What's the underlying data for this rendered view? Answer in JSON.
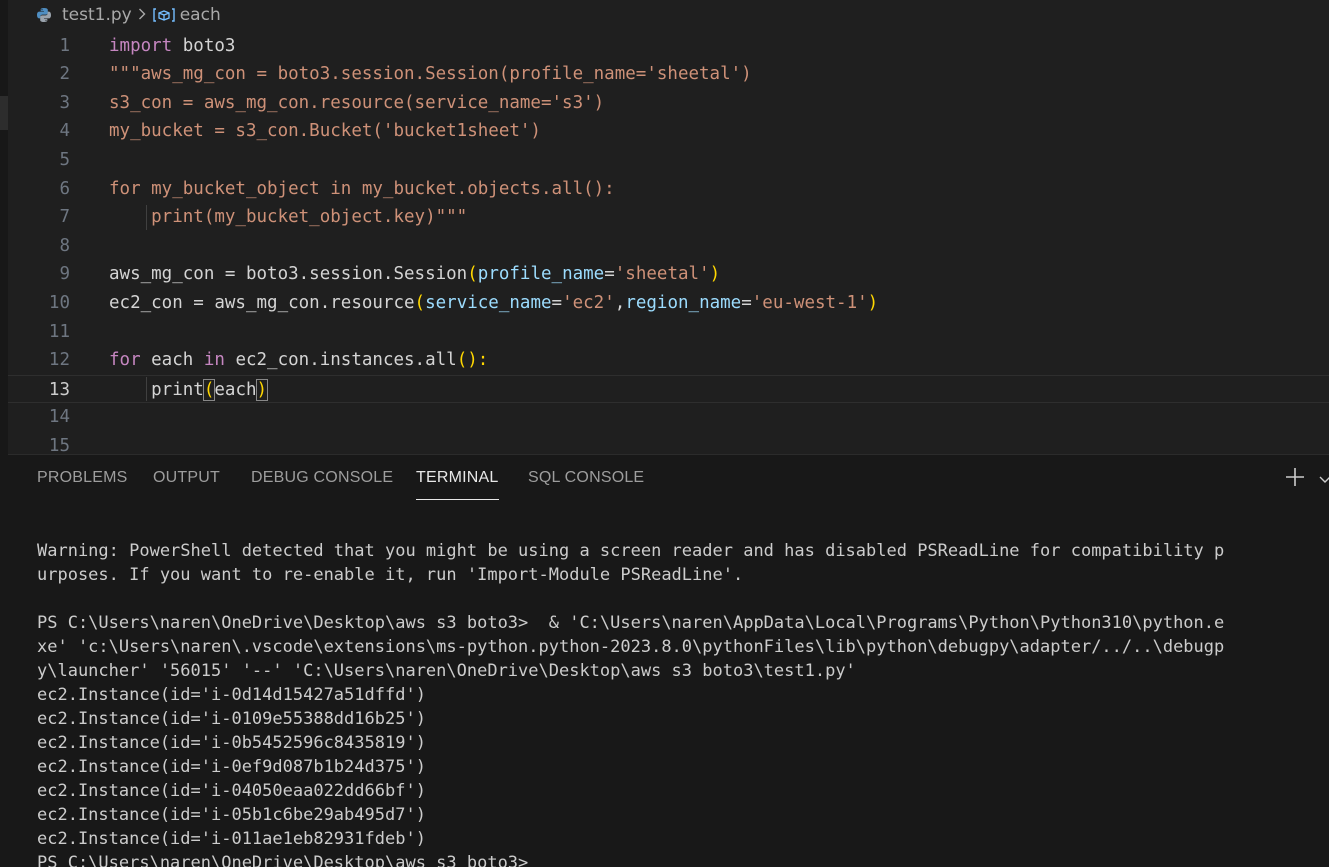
{
  "breadcrumb": {
    "file": "test1.py",
    "symbol": "each",
    "file_icon": "python-icon",
    "symbol_icon": "variable-symbol-icon"
  },
  "editor": {
    "line_numbers": [
      "1",
      "2",
      "3",
      "4",
      "5",
      "6",
      "7",
      "8",
      "9",
      "10",
      "11",
      "12",
      "13",
      "14",
      "15"
    ],
    "active_line": "13",
    "lines": [
      {
        "n": "1",
        "tokens": [
          {
            "t": "import",
            "c": "kw"
          },
          {
            "t": " boto3",
            "c": "plain"
          }
        ]
      },
      {
        "n": "2",
        "tokens": [
          {
            "t": "\"\"\"aws_mg_con = boto3.session.Session(profile_name='sheetal')",
            "c": "str"
          }
        ]
      },
      {
        "n": "3",
        "tokens": [
          {
            "t": "s3_con = aws_mg_con.resource(service_name='s3')",
            "c": "str"
          }
        ]
      },
      {
        "n": "4",
        "tokens": [
          {
            "t": "my_bucket = s3_con.Bucket('bucket1sheet')",
            "c": "str"
          }
        ]
      },
      {
        "n": "5",
        "tokens": []
      },
      {
        "n": "6",
        "tokens": [
          {
            "t": "for my_bucket_object in my_bucket.objects.all():",
            "c": "str"
          }
        ]
      },
      {
        "n": "7",
        "tokens": [
          {
            "t": "    print(my_bucket_object.key)\"\"\"",
            "c": "str"
          }
        ]
      },
      {
        "n": "8",
        "tokens": []
      },
      {
        "n": "9",
        "tokens": [
          {
            "t": "aws_mg_con = boto3.session.Session",
            "c": "plain"
          },
          {
            "t": "(",
            "c": "brk"
          },
          {
            "t": "profile_name",
            "c": "param"
          },
          {
            "t": "=",
            "c": "plain"
          },
          {
            "t": "'sheetal'",
            "c": "str"
          },
          {
            "t": ")",
            "c": "brk"
          }
        ]
      },
      {
        "n": "10",
        "tokens": [
          {
            "t": "ec2_con = aws_mg_con.resource",
            "c": "plain"
          },
          {
            "t": "(",
            "c": "brk"
          },
          {
            "t": "service_name",
            "c": "param"
          },
          {
            "t": "=",
            "c": "plain"
          },
          {
            "t": "'ec2'",
            "c": "str"
          },
          {
            "t": ",",
            "c": "plain"
          },
          {
            "t": "region_name",
            "c": "param"
          },
          {
            "t": "=",
            "c": "plain"
          },
          {
            "t": "'eu-west-1'",
            "c": "str"
          },
          {
            "t": ")",
            "c": "brk"
          }
        ]
      },
      {
        "n": "11",
        "tokens": []
      },
      {
        "n": "12",
        "tokens": [
          {
            "t": "for",
            "c": "kw"
          },
          {
            "t": " each ",
            "c": "plain"
          },
          {
            "t": "in",
            "c": "kw"
          },
          {
            "t": " ec2_con.instances.all",
            "c": "plain"
          },
          {
            "t": "():",
            "c": "brk"
          }
        ]
      },
      {
        "n": "13",
        "tokens": [
          {
            "t": "    print",
            "c": "plain"
          },
          {
            "t": "(",
            "c": "brk-match"
          },
          {
            "t": "each",
            "c": "plain"
          },
          {
            "t": ")",
            "c": "brk-match"
          }
        ]
      },
      {
        "n": "14",
        "tokens": []
      },
      {
        "n": "15",
        "tokens": []
      }
    ]
  },
  "panel": {
    "tabs": [
      "PROBLEMS",
      "OUTPUT",
      "DEBUG CONSOLE",
      "TERMINAL",
      "SQL CONSOLE"
    ],
    "active_tab": "TERMINAL",
    "add_icon": "plus-icon",
    "dropdown_icon": "chevron-down-icon"
  },
  "terminal": {
    "lines": [
      "Warning: PowerShell detected that you might be using a screen reader and has disabled PSReadLine for compatibility p",
      "urposes. If you want to re-enable it, run 'Import-Module PSReadLine'.",
      "",
      "PS C:\\Users\\naren\\OneDrive\\Desktop\\aws s3 boto3>  & 'C:\\Users\\naren\\AppData\\Local\\Programs\\Python\\Python310\\python.e",
      "xe' 'c:\\Users\\naren\\.vscode\\extensions\\ms-python.python-2023.8.0\\pythonFiles\\lib\\python\\debugpy\\adapter/../..\\debugp",
      "y\\launcher' '56015' '--' 'C:\\Users\\naren\\OneDrive\\Desktop\\aws s3 boto3\\test1.py'",
      "ec2.Instance(id='i-0d14d15427a51dffd')",
      "ec2.Instance(id='i-0109e55388dd16b25')",
      "ec2.Instance(id='i-0b5452596c8435819')",
      "ec2.Instance(id='i-0ef9d087b1b24d375')",
      "ec2.Instance(id='i-04050eaa022dd66bf')",
      "ec2.Instance(id='i-05b1c6be29ab495d7')",
      "ec2.Instance(id='i-011ae1eb82931fdeb')",
      "PS C:\\Users\\naren\\OneDrive\\Desktop\\aws s3 boto3>"
    ]
  },
  "colors": {
    "keyword": "#c586c0",
    "string": "#ce9178",
    "parameter": "#9cdcfe",
    "bracket": "#ffd700",
    "text": "#d4d4d4",
    "background": "#1f1f1f",
    "panel_background": "#181818"
  }
}
